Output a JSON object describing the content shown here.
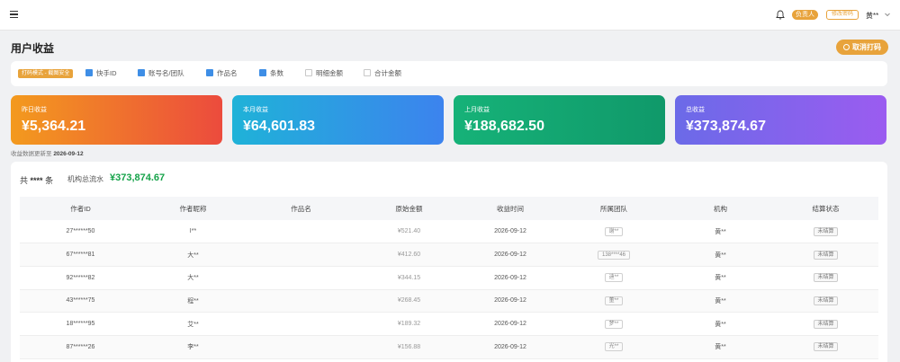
{
  "header": {
    "role_badge": "负责人",
    "change_password": "修改密码",
    "user_name": "黄**",
    "icons": {
      "menu": "menu-icon",
      "bell": "bell-icon",
      "dropdown": "chevron-down-icon"
    }
  },
  "page": {
    "title": "用户收益",
    "cancel_print": "取消打码"
  },
  "options": {
    "mode_badge": "打码模式 - 截图安全",
    "items": [
      {
        "label": "快手ID",
        "checked": true
      },
      {
        "label": "账号名/团队",
        "checked": true
      },
      {
        "label": "作品名",
        "checked": true
      },
      {
        "label": "条数",
        "checked": true
      },
      {
        "label": "明细金额",
        "checked": false
      },
      {
        "label": "合计金额",
        "checked": false
      }
    ]
  },
  "stats": [
    {
      "label": "昨日收益",
      "value": "¥5,364.21"
    },
    {
      "label": "本月收益",
      "value": "¥64,601.83"
    },
    {
      "label": "上月收益",
      "value": "¥188,682.50"
    },
    {
      "label": "总收益",
      "value": "¥373,874.67"
    }
  ],
  "updated": {
    "label": "收益数据更新至",
    "date": "2026-09-12"
  },
  "summary": {
    "count_prefix": "共",
    "count_value": "****",
    "count_suffix": "条",
    "flow_label": "机构总流水",
    "flow_value": "¥373,874.67"
  },
  "table": {
    "columns": [
      "作者ID",
      "作者昵称",
      "作品名",
      "原始金额",
      "收益时间",
      "所属团队",
      "机构",
      "结算状态"
    ],
    "rows": [
      {
        "author_id": "27******50",
        "nickname": "I**",
        "work": "",
        "amount": "¥521.40",
        "time": "2026-09-12",
        "team": "谢**",
        "org": "黄**",
        "status": "未结算"
      },
      {
        "author_id": "67******81",
        "nickname": "大**",
        "work": "",
        "amount": "¥412.60",
        "time": "2026-09-12",
        "team": "138****46",
        "org": "黄**",
        "status": "未结算"
      },
      {
        "author_id": "92******82",
        "nickname": "大**",
        "work": "",
        "amount": "¥344.15",
        "time": "2026-09-12",
        "team": "迪**",
        "org": "黄**",
        "status": "未结算"
      },
      {
        "author_id": "43******75",
        "nickname": "程**",
        "work": "",
        "amount": "¥268.45",
        "time": "2026-09-12",
        "team": "董**",
        "org": "黄**",
        "status": "未结算"
      },
      {
        "author_id": "18******95",
        "nickname": "艾**",
        "work": "",
        "amount": "¥189.32",
        "time": "2026-09-12",
        "team": "梦**",
        "org": "黄**",
        "status": "未结算"
      },
      {
        "author_id": "87******26",
        "nickname": "李**",
        "work": "",
        "amount": "¥156.88",
        "time": "2026-09-12",
        "team": "光**",
        "org": "黄**",
        "status": "未结算"
      }
    ]
  },
  "colors": {
    "accent": "#e8a33b",
    "checkbox": "#3e8ee6",
    "flow_value": "#16a34a"
  }
}
